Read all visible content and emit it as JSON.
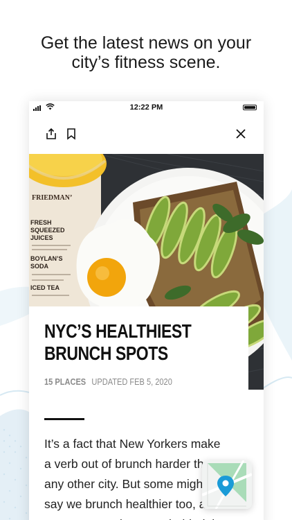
{
  "promo": {
    "line1": "Get the latest news on your",
    "line2": "city’s fitness scene."
  },
  "status_bar": {
    "time": "12:22 PM"
  },
  "toolbar": {
    "share_icon": "share-icon",
    "bookmark_icon": "bookmark-icon",
    "close_icon": "close-icon"
  },
  "hero": {
    "menu_brand": "FRIEDMAN’",
    "menu_lines": [
      "FRESH",
      "SQUEEZED",
      "JUICES",
      "BOYLAN’S",
      "SODA",
      "ICED TEA"
    ]
  },
  "article": {
    "title_line1": "NYC’S HEALTHIEST",
    "title_line2": "BRUNCH SPOTS",
    "place_count": "15 PLACES",
    "updated": "UPDATED FEB 5, 2020",
    "body_lines": [
      "It’s a fact that New Yorkers make",
      "a verb out of brunch harder than",
      "any other city. But some might",
      "say we brunch healthier too, and",
      "we can prove it. Leave behind the"
    ]
  },
  "map_button": {
    "icon": "map-pin-icon"
  },
  "colors": {
    "accent_map_pin": "#1a9bd7",
    "map_green": "#9ed7b0",
    "deco_blue": "#e3f0f7"
  }
}
